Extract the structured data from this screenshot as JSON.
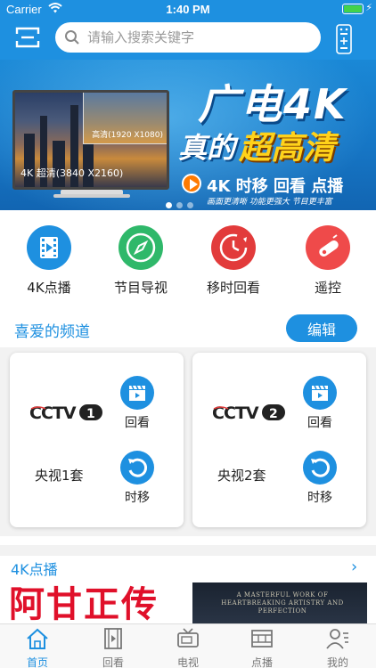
{
  "status_bar": {
    "carrier": "Carrier",
    "time": "1:40 PM"
  },
  "header": {
    "search_placeholder": "请输入搜索关键字",
    "menu_icon": "scan-icon",
    "remote_icon": "remote-icon",
    "accent_color": "#1e90e0"
  },
  "banner": {
    "title_line1": "广电4K",
    "title_line2_a": "真的",
    "title_line2_b": "超高清",
    "subtitle": "4K 时移 回看 点播",
    "tagline": "画面更清晰  功能更强大  节目更丰富",
    "hd_label": "高清(1920 X1080)",
    "uhd_label": "4K 超清(3840 X2160)",
    "page_count": 3,
    "active_page": 1
  },
  "quick_entries": [
    {
      "label": "4K点播",
      "icon": "film-play-icon",
      "color": "#1e90e0"
    },
    {
      "label": "节目导视",
      "icon": "compass-icon",
      "color": "#2fb86a"
    },
    {
      "label": "移时回看",
      "icon": "clock-rewind-icon",
      "color": "#e23b3b"
    },
    {
      "label": "遥控",
      "icon": "remote-icon",
      "color": "#ef4a4a"
    }
  ],
  "favorites": {
    "title": "喜爱的频道",
    "edit_label": "编辑",
    "channels": [
      {
        "logo_text": "CCTV",
        "logo_num": "1",
        "name": "央视1套",
        "replay_label": "回看",
        "timeshift_label": "时移"
      },
      {
        "logo_text": "CCTV",
        "logo_num": "2",
        "name": "央视2套",
        "replay_label": "回看",
        "timeshift_label": "时移"
      }
    ]
  },
  "section_4k": {
    "title": "4K点播",
    "more_icon": "chevron-right-icon",
    "posters": [
      {
        "title": "阿甘正传"
      },
      {
        "title": "A MASTERFUL WORK OF HEARTBREAKING ARTISTRY AND PERFECTION"
      }
    ]
  },
  "tabbar": {
    "tabs": [
      {
        "label": "首页",
        "icon": "home-icon",
        "active": true
      },
      {
        "label": "回看",
        "icon": "film-icon",
        "active": false
      },
      {
        "label": "电视",
        "icon": "tv-icon",
        "active": false
      },
      {
        "label": "点播",
        "icon": "film-strip-icon",
        "active": false
      },
      {
        "label": "我的",
        "icon": "user-icon",
        "active": false
      }
    ]
  }
}
